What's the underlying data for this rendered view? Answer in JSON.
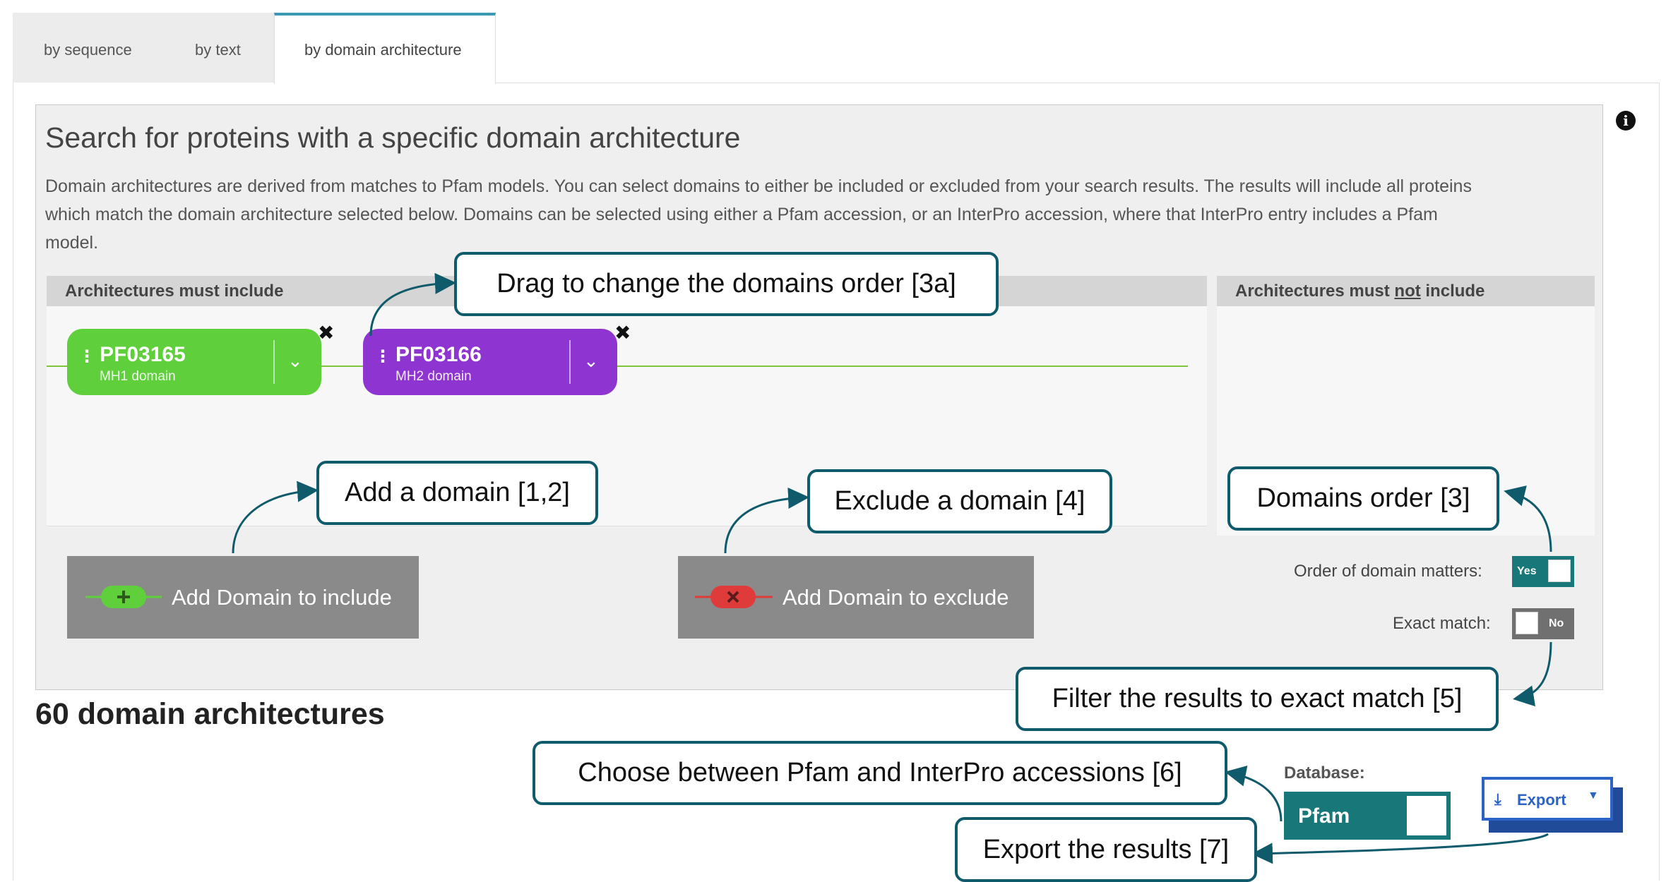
{
  "tabs": [
    {
      "label": "by sequence"
    },
    {
      "label": "by text"
    },
    {
      "label": "by domain architecture"
    }
  ],
  "panel": {
    "title": "Search for proteins with a specific domain architecture",
    "description_lines": [
      "Domain architectures are derived from matches to Pfam models. You can select domains to either be included or excluded from your search results. The results will include all proteins",
      "which match the domain architecture selected below. Domains can be selected using either a Pfam accession, or an InterPro accession, where that InterPro entry includes a Pfam",
      "model."
    ],
    "include_header": "Architectures must include",
    "exclude_header_pre": "Architectures must ",
    "exclude_header_not": "not",
    "exclude_header_post": " include"
  },
  "domains": [
    {
      "accession": "PF03165",
      "name": "MH1 domain",
      "color": "#5fcf3c"
    },
    {
      "accession": "PF03166",
      "name": "MH2 domain",
      "color": "#8e35d1"
    }
  ],
  "buttons": {
    "add_include": "Add Domain to include",
    "add_exclude": "Add Domain to exclude",
    "export": "Export",
    "close": "✖"
  },
  "options": {
    "order_label": "Order of domain matters:",
    "order_value": "Yes",
    "exact_label": "Exact match:",
    "exact_value": "No"
  },
  "results": {
    "count_text": "60 domain architectures",
    "database_label": "Database:",
    "database_value": "Pfam"
  },
  "callouts": {
    "drag": "Drag to change the domains order [3a]",
    "add": "Add a domain [1,2]",
    "exclude": "Exclude a domain [4]",
    "order": "Domains order [3]",
    "exact": "Filter the results to exact match [5]",
    "choose": "Choose between Pfam and InterPro accessions [6]",
    "export": "Export the results [7]"
  },
  "colors": {
    "accent_tab": "#3c9ab2",
    "callout_border": "#0f5b6b",
    "toggle_on": "#177779",
    "export_blue": "#2b63c6"
  }
}
